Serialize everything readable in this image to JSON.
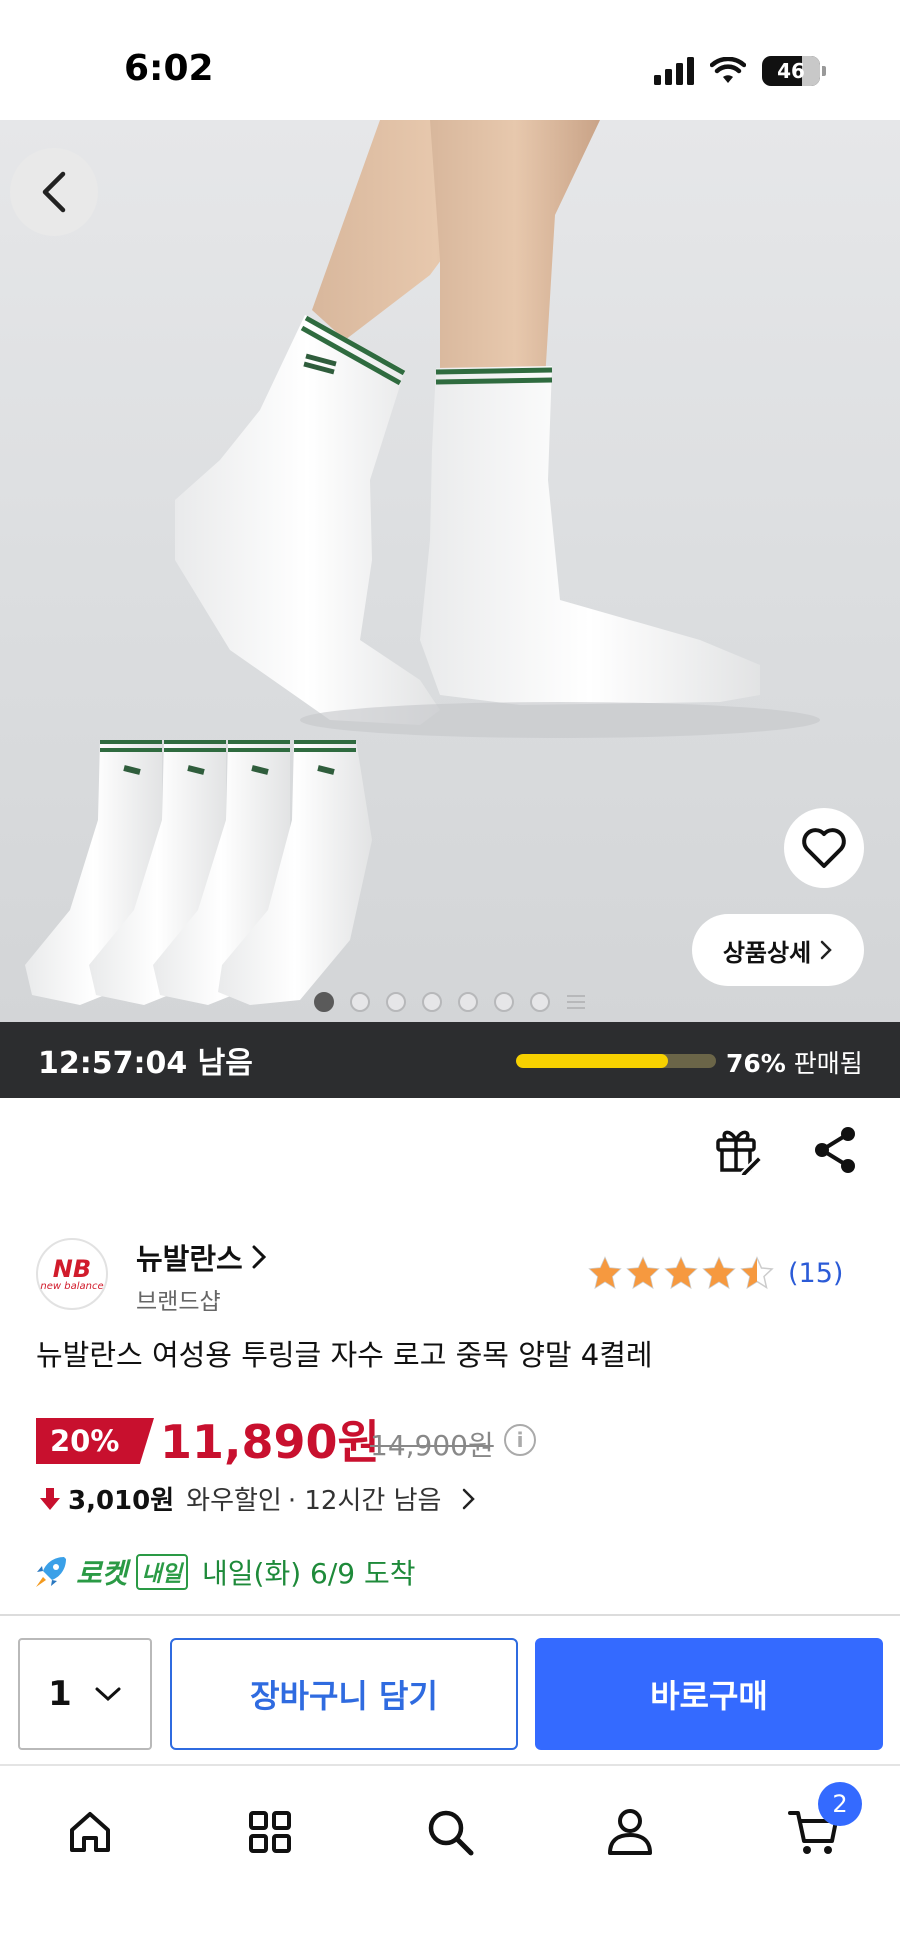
{
  "status_bar": {
    "time": "6:02",
    "battery": "46"
  },
  "hero": {
    "detail_label": "상품상세",
    "image_count": 7,
    "active_index": 0
  },
  "timer": {
    "remaining_text": "12:57:04 남음",
    "sold_percent": 76,
    "sold_label_pct": "76%",
    "sold_label_text": "판매됨"
  },
  "brand": {
    "name": "뉴발란스",
    "subtitle": "브랜드샵",
    "logo_text": "NB",
    "logo_small_text": "new balance"
  },
  "rating": {
    "value": 4.5,
    "count_text": "(15)"
  },
  "product": {
    "title": "뉴발란스 여성용 투링글 자수 로고 중목 양말 4켤레"
  },
  "price": {
    "discount": "20%",
    "sale_price": "11,890원",
    "original_price": "14,900원",
    "info_symbol": "i",
    "wow_amount": "3,010원",
    "wow_label": "와우할인",
    "wow_time": "· 12시간 남음"
  },
  "delivery": {
    "rocket": "로켓",
    "badge": "내일",
    "date_text": "내일(화) 6/9 도착"
  },
  "purchase": {
    "quantity": "1",
    "cart_label": "장바구니 담기",
    "buy_label": "바로구매"
  },
  "tab_bar": {
    "cart_count": "2"
  },
  "colors": {
    "accent_blue": "#346aff",
    "price_red": "#c8102e",
    "rocket_green": "#2a9a45",
    "progress_yellow": "#f7d100"
  }
}
